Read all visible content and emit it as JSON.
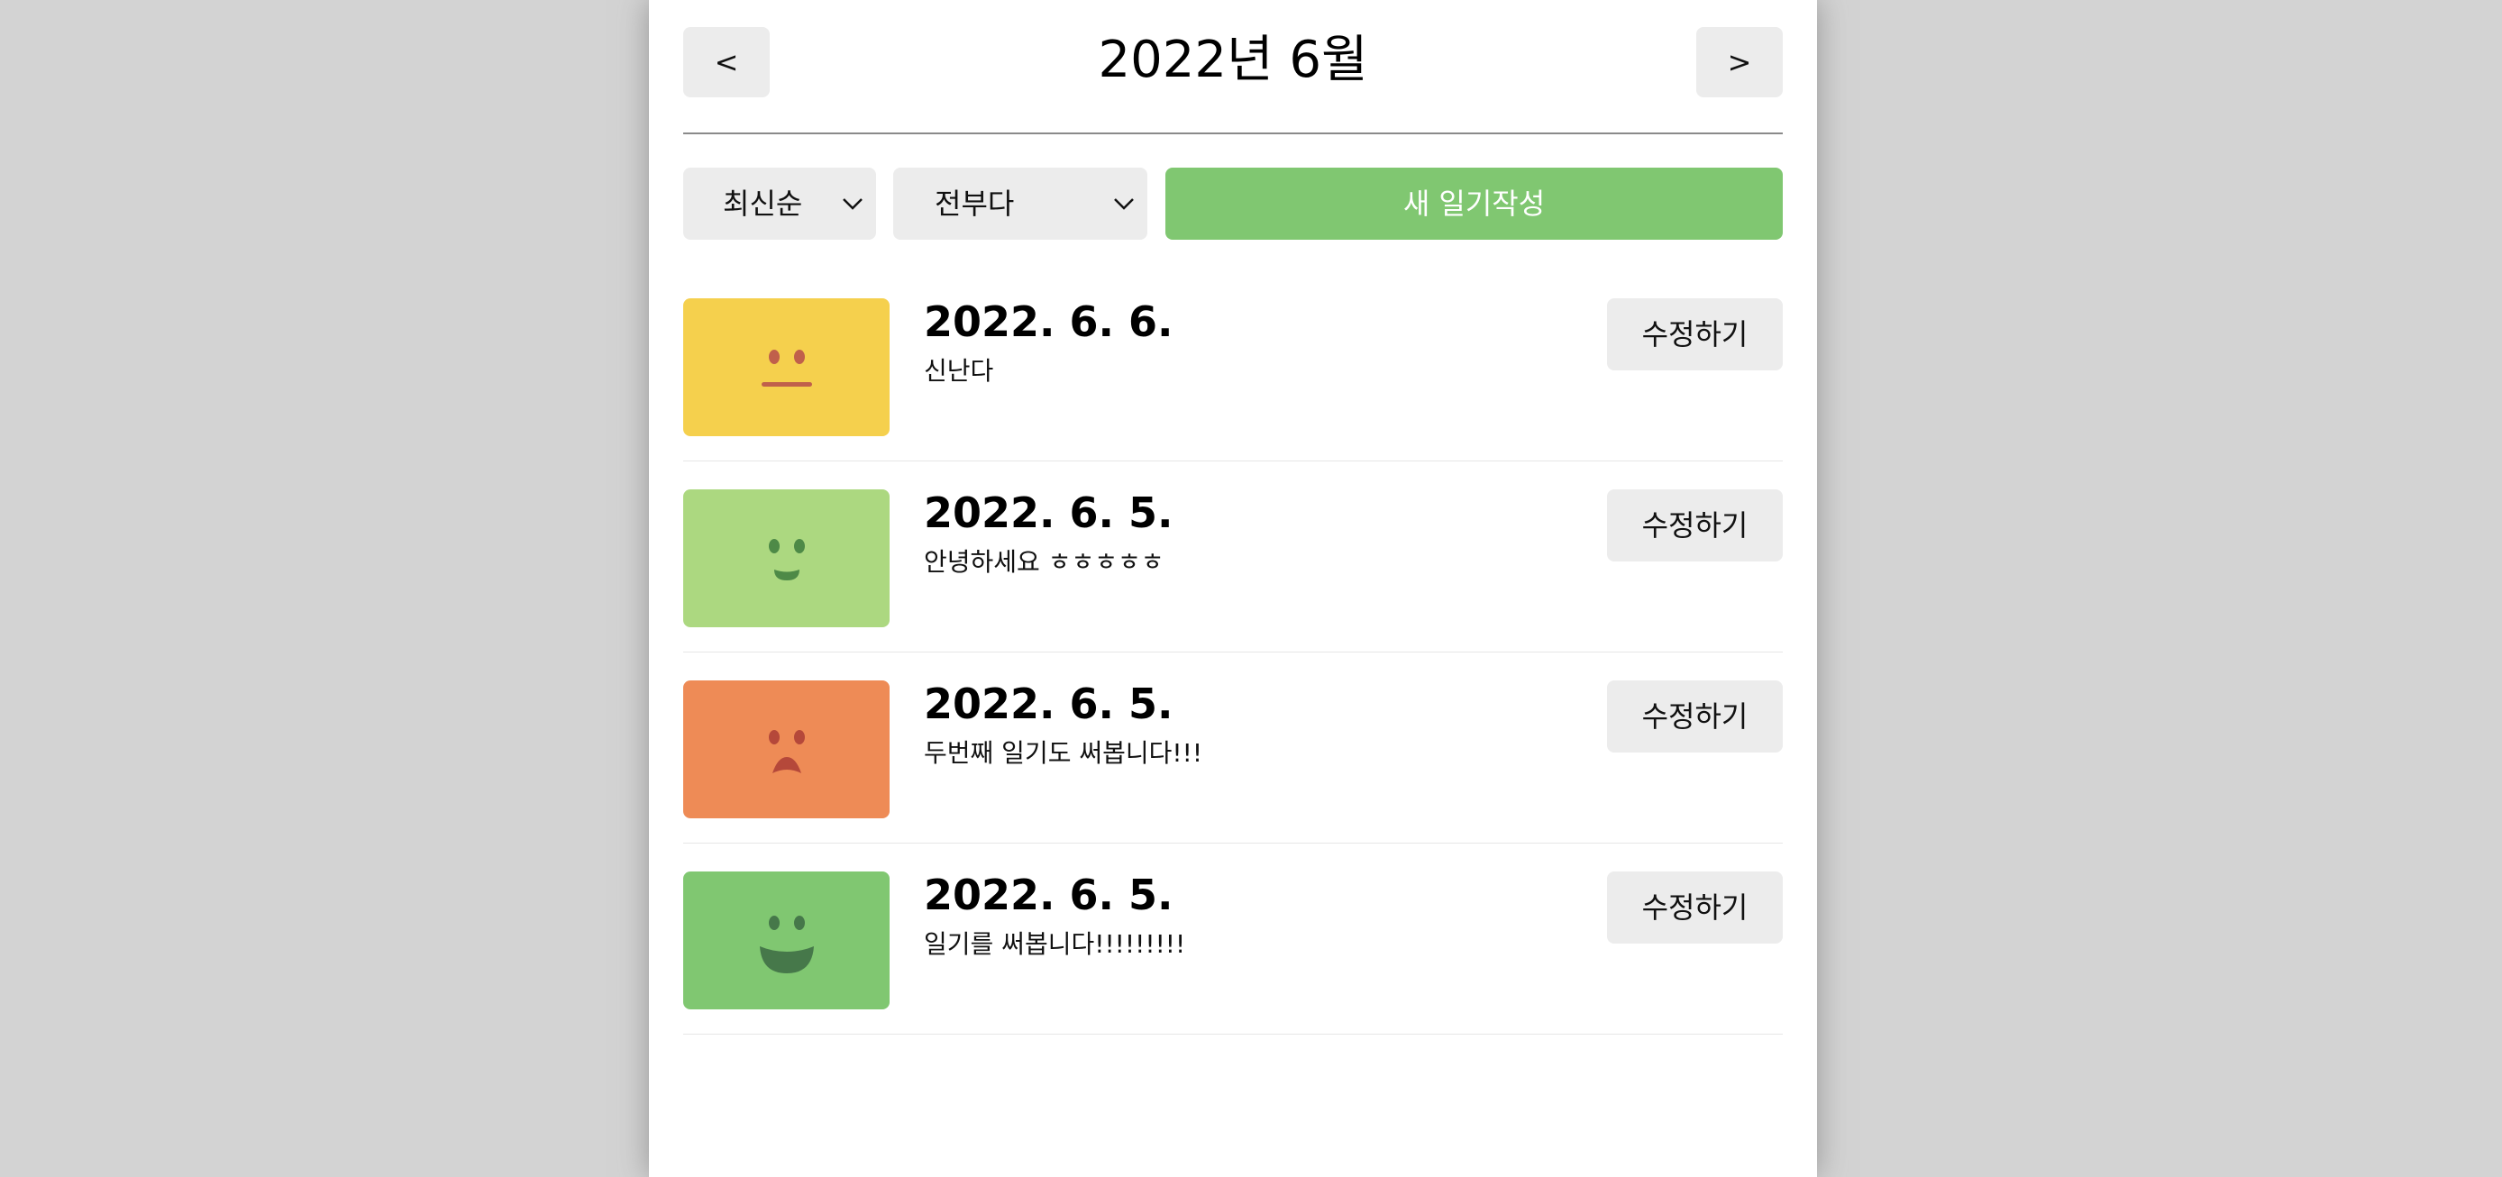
{
  "header": {
    "title": "2022년 6월",
    "prev_label": "<",
    "next_label": ">"
  },
  "controls": {
    "sort_selected": "최신순",
    "filter_selected": "전부다",
    "new_button_label": "새 일기작성"
  },
  "colors": {
    "accent_green": "#80c771",
    "background": "#d3d3d3",
    "button_gray": "#ececec"
  },
  "entries": [
    {
      "emotion_icon": "neutral-face-icon",
      "color": "#f5d04d",
      "date": "2022. 6. 6.",
      "content": "신난다",
      "edit_label": "수정하기"
    },
    {
      "emotion_icon": "smile-face-icon",
      "color": "#acd880",
      "date": "2022. 6. 5.",
      "content": "안녕하세요 ㅎㅎㅎㅎㅎ",
      "edit_label": "수정하기"
    },
    {
      "emotion_icon": "sad-face-icon",
      "color": "#ee8b56",
      "date": "2022. 6. 5.",
      "content": "두번째 일기도 써봅니다!!!",
      "edit_label": "수정하기"
    },
    {
      "emotion_icon": "big-smile-face-icon",
      "color": "#80c771",
      "date": "2022. 6. 5.",
      "content": "일기를 써봅니다!!!!!!!!!",
      "edit_label": "수정하기"
    }
  ]
}
